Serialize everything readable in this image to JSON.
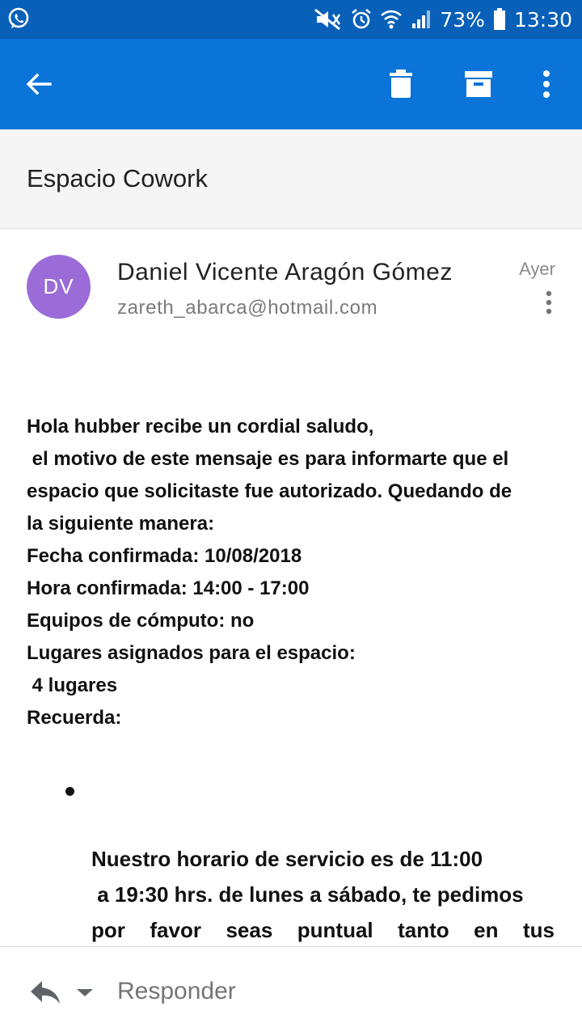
{
  "status_bar": {
    "battery": "73%",
    "time": "13:30",
    "icons": [
      "whatsapp-icon",
      "mute-icon",
      "alarm-icon",
      "wifi-icon",
      "signal-icon",
      "battery-icon"
    ]
  },
  "toolbar": {
    "icons": [
      "back-arrow-icon",
      "delete-icon",
      "archive-icon",
      "more-vert-icon"
    ]
  },
  "email": {
    "subject": "Espacio Cowork",
    "sender": {
      "initials": "DV",
      "name": "Daniel Vicente Aragón Gómez",
      "email": "zareth_abarca@hotmail.com",
      "date": "Ayer",
      "avatar_color": "#9b6cd8"
    },
    "body_lines": [
      "Hola hubber recibe un cordial saludo,",
      " el motivo de este mensaje es para informarte que el",
      "espacio que solicitaste fue autorizado. Quedando de",
      "la siguiente manera:",
      "Fecha confirmada: 10/08/2018",
      "Hora confirmada: 14:00 - 17:00",
      "Equipos de cómputo: no",
      "Lugares asignados para el espacio:",
      " 4 lugares",
      "Recuerda:"
    ],
    "bullet_paragraph": [
      "Nuestro horario de servicio es de 11:00",
      " a 19:30 hrs. de lunes a sábado, te pedimos",
      "por favor seas puntual tanto en tus"
    ]
  },
  "reply_bar": {
    "label": "Responder"
  },
  "colors": {
    "status_bar": "#0860b8",
    "app_bar": "#0a74d8",
    "subject_bg": "#f5f5f5"
  }
}
